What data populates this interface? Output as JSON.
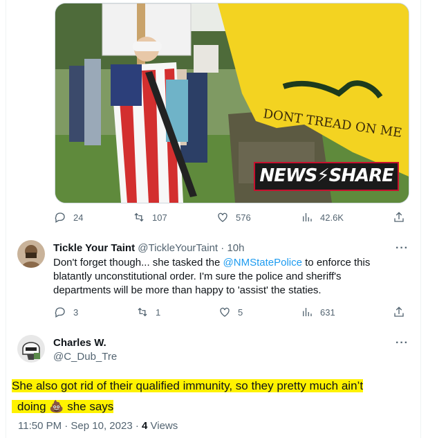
{
  "media": {
    "watermark": "NEWS⚡SHARE",
    "flag_text": "DONT TREAD ON ME"
  },
  "tweet1_stats": {
    "replies": "24",
    "retweets": "107",
    "likes": "576",
    "views": "42.6K"
  },
  "reply": {
    "name": "Tickle Your Taint",
    "handle": "@TickleYourTaint",
    "sep": "·",
    "time": "10h",
    "text_1": "Don't forget though... she tasked the ",
    "mention": "@NMStatePolice",
    "text_2": " to enforce this blatantly unconstitutional order. I'm sure the police and sheriff's departments will be more than happy to 'assist' the staties.",
    "stats": {
      "replies": "3",
      "retweets": "1",
      "likes": "5",
      "views": "631"
    }
  },
  "main": {
    "name": "Charles W.",
    "handle": "@C_Dub_Tre",
    "line_1": "She also got rid of their qualified immunity, so they pretty much ain’t",
    "line_2_a": "doing ",
    "emoji": "💩",
    "line_2_b": " she says",
    "time": "11:50 PM · Sep 10, 2023 · ",
    "views_count": "4",
    "views_label": " Views"
  },
  "more_label": "···",
  "colors": {
    "accent": "#1d9bf0",
    "highlight": "#fff200",
    "muted": "#536471"
  }
}
